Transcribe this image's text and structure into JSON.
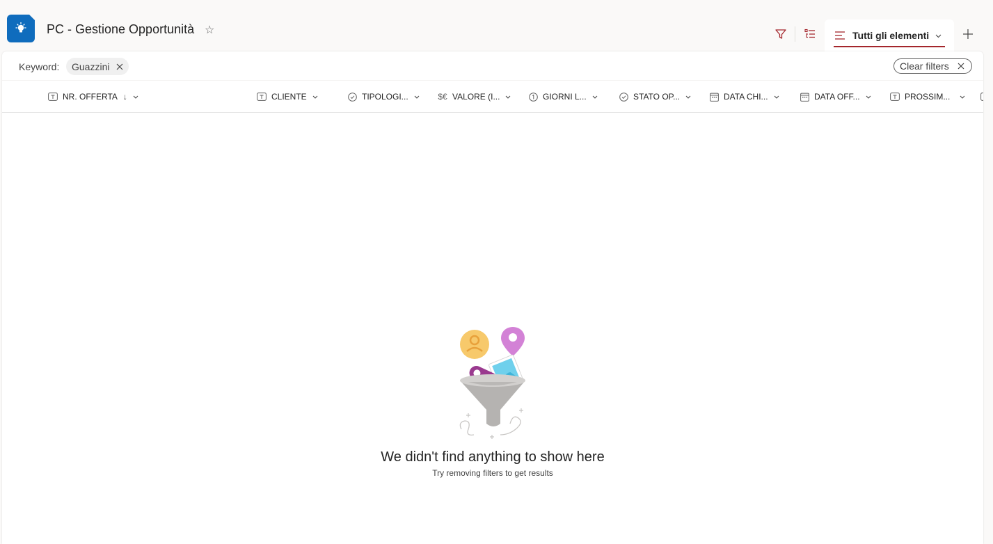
{
  "header": {
    "title": "PC - Gestione Opportunità",
    "view_label": "Tutti gli elementi",
    "accent_color": "#a4262c",
    "app_icon_color": "#0f6cbd"
  },
  "filters": {
    "keyword_label": "Keyword:",
    "keyword_value": "Guazzini",
    "clear_label": "Clear filters"
  },
  "columns": [
    {
      "label": "NR. OFFERTA",
      "icon": "text-field-icon",
      "sorted": "descending"
    },
    {
      "label": "CLIENTE",
      "icon": "text-field-icon"
    },
    {
      "label": "TIPOLOGI...",
      "icon": "choice-field-icon"
    },
    {
      "label": "VALORE (I...",
      "icon": "currency-field-icon"
    },
    {
      "label": "GIORNI L...",
      "icon": "number-field-icon"
    },
    {
      "label": "STATO OP...",
      "icon": "choice-field-icon"
    },
    {
      "label": "DATA CHI...",
      "icon": "calendar-field-icon"
    },
    {
      "label": "DATA OFF...",
      "icon": "calendar-field-icon"
    },
    {
      "label": "PROSSIM...",
      "icon": "text-field-icon"
    }
  ],
  "empty_state": {
    "title": "We didn't find anything to show here",
    "subtitle": "Try removing filters to get results"
  }
}
